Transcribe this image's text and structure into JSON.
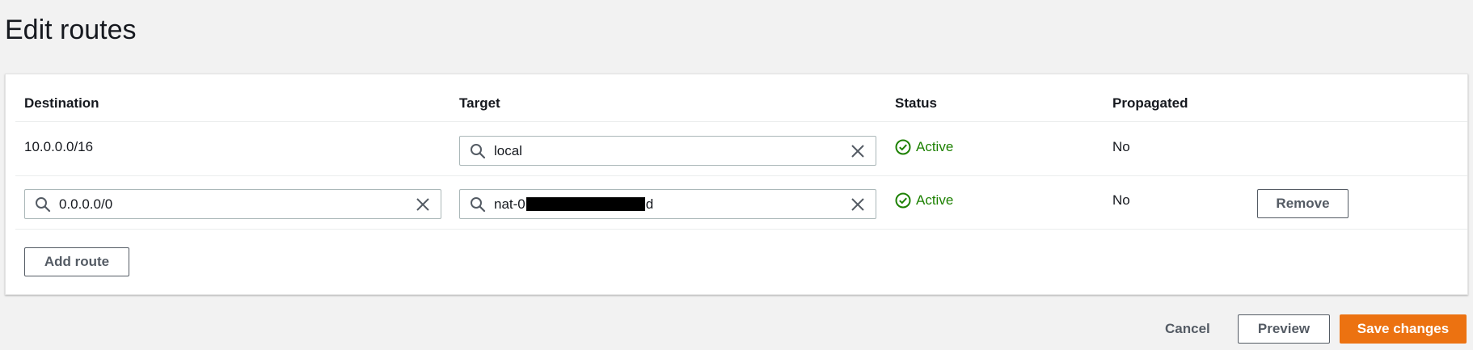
{
  "page": {
    "title": "Edit routes"
  },
  "table": {
    "columns": [
      "Destination",
      "Target",
      "Status",
      "Propagated"
    ],
    "rows": [
      {
        "destination": "10.0.0.0/16",
        "target": "local",
        "status": "Active",
        "propagated": "No"
      },
      {
        "destination": "0.0.0.0/0",
        "target_prefix": "nat-0",
        "target_suffix": "d",
        "status": "Active",
        "propagated": "No",
        "remove_label": "Remove"
      }
    ],
    "add_route_label": "Add route"
  },
  "footer": {
    "cancel_label": "Cancel",
    "preview_label": "Preview",
    "save_label": "Save changes"
  },
  "icons": {
    "search": "search-icon",
    "clear": "close-icon",
    "status": "check-circle-icon"
  },
  "colors": {
    "primary": "#ec7211",
    "active": "#1d8102",
    "background": "#f2f2f2"
  }
}
